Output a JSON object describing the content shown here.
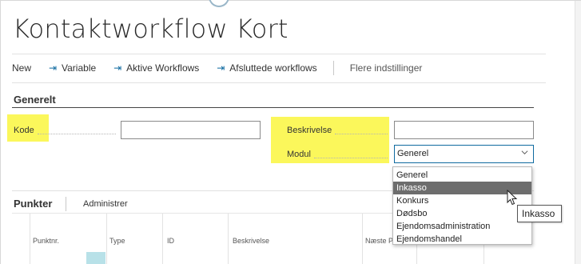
{
  "page": {
    "title": "Kontaktworkflow Kort"
  },
  "actionbar": {
    "new_label": "New",
    "variable_label": "Variable",
    "aktive_label": "Aktive Workflows",
    "afsluttede_label": "Afsluttede workflows",
    "more_label": "Flere indstillinger"
  },
  "general": {
    "section_title": "Generelt",
    "kode_label": "Kode",
    "kode_value": "",
    "beskrivelse_label": "Beskrivelse",
    "beskrivelse_value": "",
    "modul_label": "Modul",
    "modul_value": "Generel"
  },
  "dropdown": {
    "options": [
      "Generel",
      "Inkasso",
      "Konkurs",
      "Dødsbo",
      "Ejendomsadministration",
      "Ejendomshandel"
    ],
    "highlighted": "Inkasso"
  },
  "tooltip": {
    "text": "Inkasso"
  },
  "punkter": {
    "title": "Punkter",
    "administrer_label": "Administrer",
    "columns": [
      "Punktnr.",
      "Type",
      "ID",
      "Beskrivelse",
      "Næste P"
    ]
  },
  "colors": {
    "highlight": "#fbf75b",
    "accent": "#0f6aa0",
    "selected_option": "#6d6d6d",
    "teal_cell": "#b8e1e8"
  },
  "icons": {
    "action": "arrow-into-icon",
    "select": "chevron-down-icon",
    "cursor": "mouse-pointer-icon"
  }
}
